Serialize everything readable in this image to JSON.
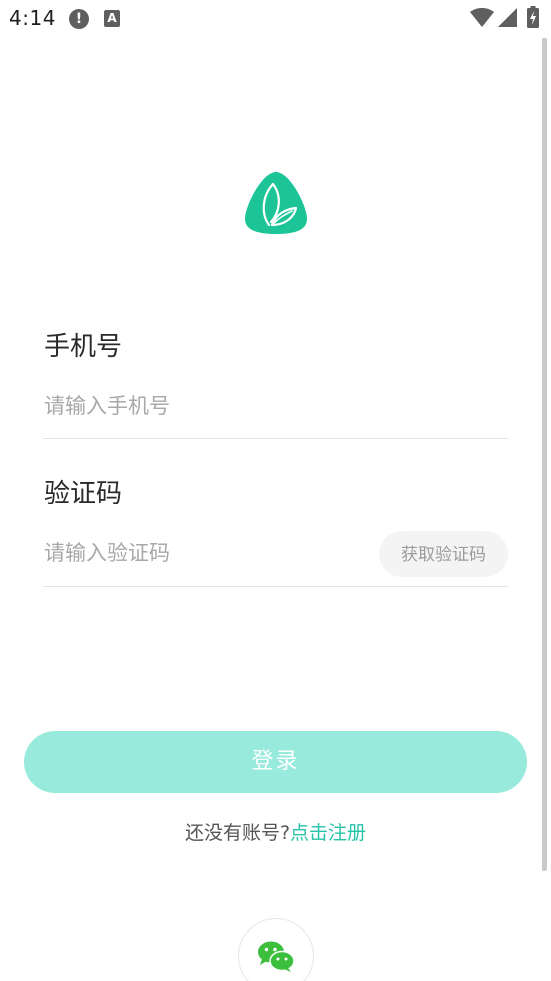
{
  "status_bar": {
    "time": "4:14",
    "alert_glyph": "!",
    "keyboard_glyph": "A",
    "icons": [
      "alert-icon",
      "keyboard-icon",
      "wifi-icon",
      "signal-icon",
      "battery-icon"
    ]
  },
  "brand": {
    "logo_icon": "leaf-logo-icon",
    "accent_color": "#1cc497"
  },
  "form": {
    "phone_label": "手机号",
    "phone_placeholder": "请输入手机号",
    "phone_value": "",
    "code_label": "验证码",
    "code_placeholder": "请输入验证码",
    "code_value": "",
    "get_code_label": "获取验证码"
  },
  "actions": {
    "login_label": "登录",
    "register_prompt": "还没有账号?",
    "register_link": "点击注册"
  },
  "social": {
    "wechat_icon": "wechat-icon"
  }
}
